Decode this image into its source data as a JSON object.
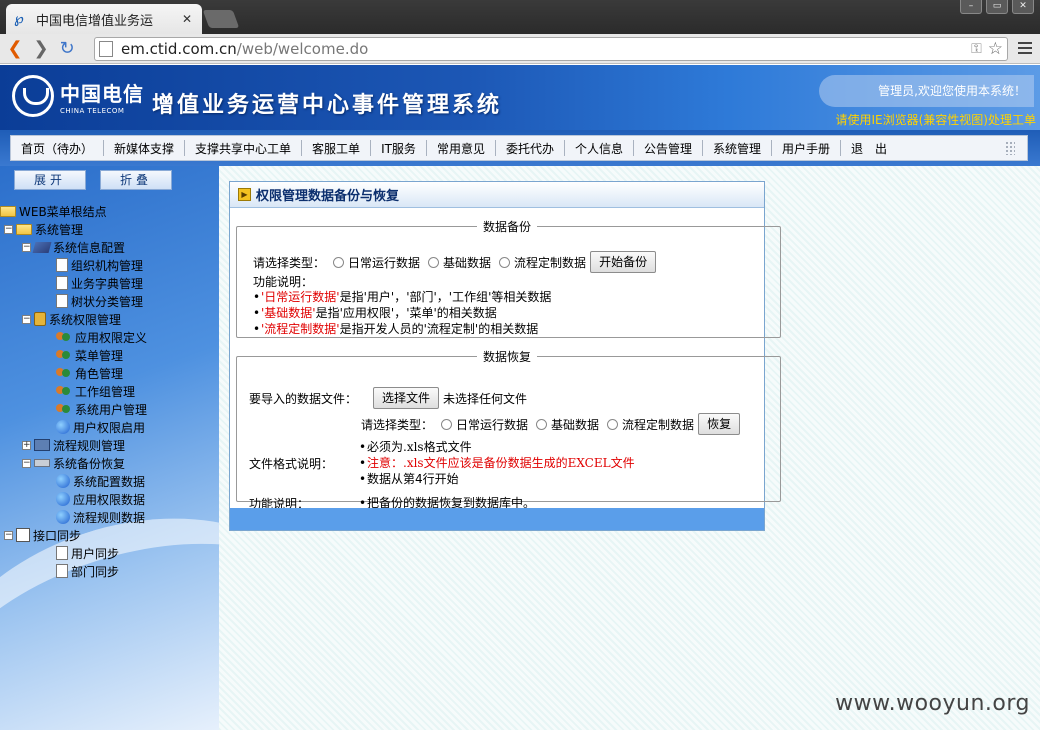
{
  "browser": {
    "tab_title": "中国电信增值业务运",
    "url_host": "em.ctid.com.cn",
    "url_path": "/web/welcome.do"
  },
  "header": {
    "logo_cn": "中国电信",
    "logo_en": "CHINA TELECOM",
    "system_title": "增值业务运营中心事件管理系统",
    "welcome": "管理员,欢迎您使用本系统！",
    "ie_notice": "请使用IE浏览器(兼容性视图)处理工单"
  },
  "menu": [
    "首页（待办）",
    "新媒体支撑",
    "支撑共享中心工单",
    "客服工单",
    "IT服务",
    "常用意见",
    "委托代办",
    "个人信息",
    "公告管理",
    "系统管理",
    "用户手册",
    "退　出"
  ],
  "sidebar": {
    "expand": "展开",
    "collapse": "折叠",
    "tree": [
      {
        "label": "WEB菜单根结点",
        "level": 0,
        "icon": "folder",
        "pm": ""
      },
      {
        "label": "系统管理",
        "level": 1,
        "icon": "folder",
        "pm": "−"
      },
      {
        "label": "系统信息配置",
        "level": 2,
        "icon": "book",
        "pm": "−"
      },
      {
        "label": "组织机构管理",
        "level": 3,
        "icon": "doc",
        "pm": ""
      },
      {
        "label": "业务字典管理",
        "level": 3,
        "icon": "doc",
        "pm": ""
      },
      {
        "label": "树状分类管理",
        "level": 3,
        "icon": "doc",
        "pm": ""
      },
      {
        "label": "系统权限管理",
        "level": 2,
        "icon": "lock",
        "pm": "−"
      },
      {
        "label": "应用权限定义",
        "level": 3,
        "icon": "users",
        "pm": ""
      },
      {
        "label": "菜单管理",
        "level": 3,
        "icon": "users",
        "pm": ""
      },
      {
        "label": "角色管理",
        "level": 3,
        "icon": "users",
        "pm": ""
      },
      {
        "label": "工作组管理",
        "level": 3,
        "icon": "users",
        "pm": ""
      },
      {
        "label": "系统用户管理",
        "level": 3,
        "icon": "users",
        "pm": ""
      },
      {
        "label": "用户权限启用",
        "level": 3,
        "icon": "globe",
        "pm": ""
      },
      {
        "label": "流程规则管理",
        "level": 2,
        "icon": "pc",
        "pm": "+"
      },
      {
        "label": "系统备份恢复",
        "level": 2,
        "icon": "drive",
        "pm": "−"
      },
      {
        "label": "系统配置数据",
        "level": 3,
        "icon": "globe",
        "pm": ""
      },
      {
        "label": "应用权限数据",
        "level": 3,
        "icon": "globe",
        "pm": ""
      },
      {
        "label": "流程规则数据",
        "level": 3,
        "icon": "globe",
        "pm": ""
      },
      {
        "label": "接口同步",
        "level": 1,
        "icon": "sync",
        "pm": "−"
      },
      {
        "label": "用户同步",
        "level": 3,
        "icon": "doc",
        "pm": ""
      },
      {
        "label": "部门同步",
        "level": 3,
        "icon": "doc",
        "pm": ""
      }
    ]
  },
  "panel": {
    "title": "权限管理数据备份与恢复",
    "backup": {
      "legend": "数据备份",
      "type_label": "请选择类型：",
      "options": [
        "日常运行数据",
        "基础数据",
        "流程定制数据"
      ],
      "button": "开始备份",
      "func_label": "功能说明：",
      "notes": [
        {
          "hl": "'日常运行数据'",
          "rest": "是指'用户'，'部门'，'工作组'等相关数据"
        },
        {
          "hl": "'基础数据'",
          "rest": "是指'应用权限'，'菜单'的相关数据"
        },
        {
          "hl": "'流程定制数据'",
          "rest": "是指开发人员的'流程定制'的相关数据"
        }
      ]
    },
    "restore": {
      "legend": "数据恢复",
      "file_label": "要导入的数据文件：",
      "file_button": "选择文件",
      "file_status": "未选择任何文件",
      "type_label": "请选择类型：",
      "options": [
        "日常运行数据",
        "基础数据",
        "流程定制数据"
      ],
      "button": "恢复",
      "format_label": "文件格式说明：",
      "format_1": "必须为.xls格式文件",
      "format_warn": "注意：.xls文件应该是备份数据生成的EXCEL文件",
      "format_2": "数据从第4行开始",
      "func_label": "功能说明：",
      "func_1": "把备份的数据恢复到数据库中。"
    }
  },
  "watermark": "www.wooyun.org"
}
